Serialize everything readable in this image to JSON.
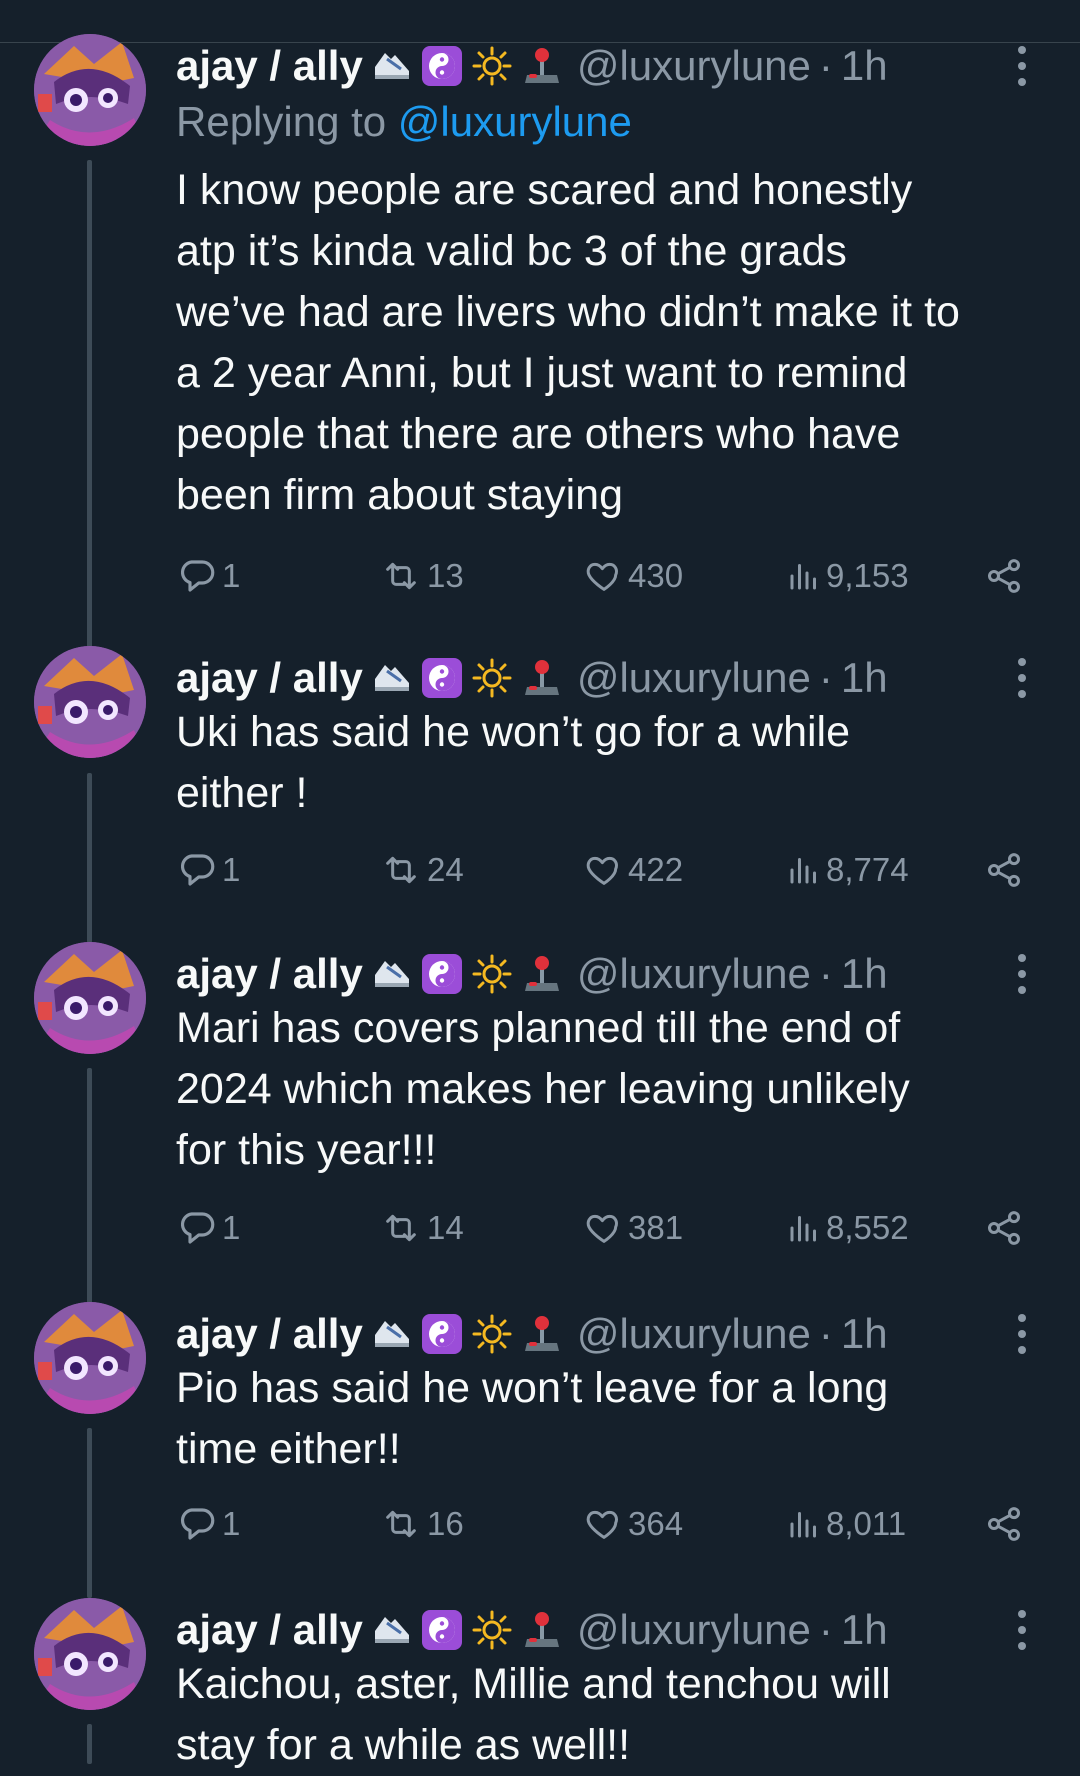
{
  "author": {
    "display_name": "ajay / ally",
    "handle": "@luxurylune",
    "emoji_icons": [
      "running-shoe-icon",
      "yin-yang-icon",
      "sun-icon",
      "joystick-icon"
    ]
  },
  "colors": {
    "background": "#15202b",
    "text": "#f7f9f9",
    "secondary_text": "#8b98a5",
    "link": "#1d9bf0",
    "thread_line": "#3d4b57"
  },
  "tweets": [
    {
      "time": "1h",
      "replying_label": "Replying to",
      "replying_to": "@luxurylune",
      "lines": [
        "I know people are scared and honestly",
        "atp it’s kinda valid bc 3 of the grads",
        "we’ve had are livers who didn’t make it to",
        "a 2 year Anni, but I just want to remind",
        "people that there are others who have",
        "been firm about staying"
      ],
      "replies": "1",
      "retweets": "13",
      "likes": "430",
      "views": "9,153"
    },
    {
      "time": "1h",
      "lines": [
        "Uki has said he won’t go for a while",
        "either !"
      ],
      "replies": "1",
      "retweets": "24",
      "likes": "422",
      "views": "8,774"
    },
    {
      "time": "1h",
      "lines": [
        "Mari has covers planned till the end of",
        "2024 which makes her leaving unlikely",
        "for this year!!!"
      ],
      "replies": "1",
      "retweets": "14",
      "likes": "381",
      "views": "8,552"
    },
    {
      "time": "1h",
      "lines": [
        "Pio has said he won’t leave for a long",
        "time either!!"
      ],
      "replies": "1",
      "retweets": "16",
      "likes": "364",
      "views": "8,011"
    },
    {
      "time": "1h",
      "lines": [
        "Kaichou, aster, Millie and tenchou will",
        "stay for a while as well!!"
      ]
    }
  ]
}
